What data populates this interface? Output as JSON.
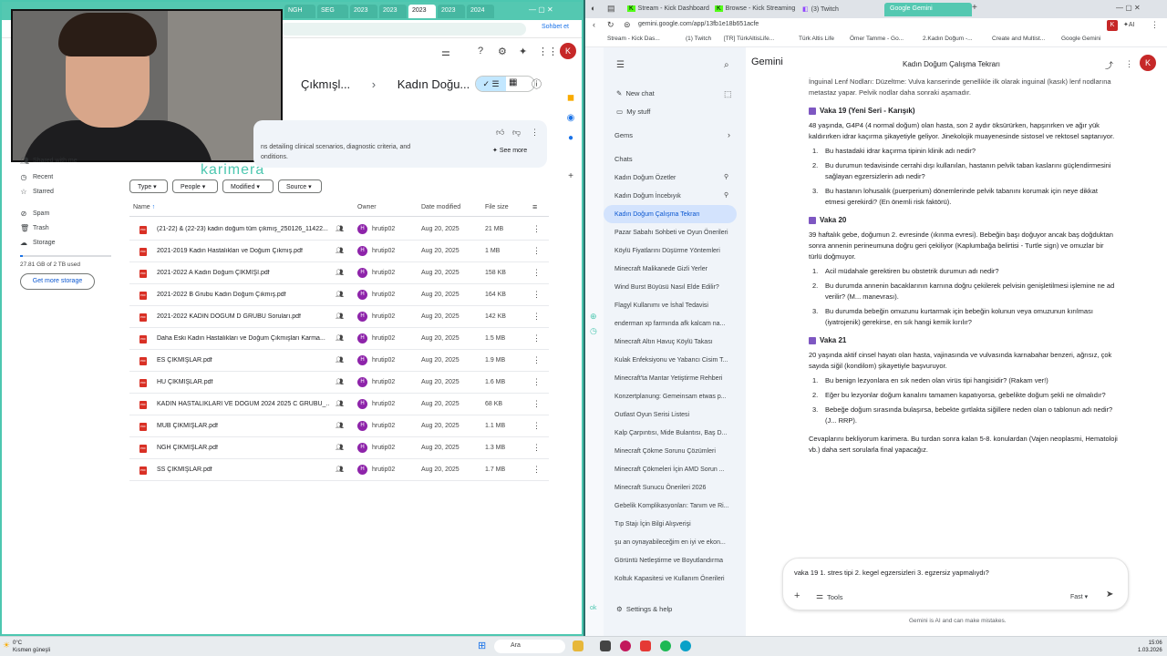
{
  "left_window": {
    "tabs": [
      "NGH",
      "SEG",
      "2023",
      "2023",
      "2023",
      "2023",
      "2024"
    ],
    "schbtn": "Sohbet et",
    "overlay_text": "karimera",
    "breadcrumb": [
      "Çıkmışl...",
      "Kadın Doğu..."
    ],
    "ai_summary": {
      "text_line1": "ns detailing clinical scenarios, diagnostic criteria, and",
      "text_line2": "onditions.",
      "see_more": "See more"
    },
    "nav": [
      {
        "label": "Shared with me",
        "icon": "people-icon"
      },
      {
        "label": "Recent",
        "icon": "clock-icon"
      },
      {
        "label": "Starred",
        "icon": "star-icon"
      },
      {
        "label": "Spam",
        "icon": "spam-icon"
      },
      {
        "label": "Trash",
        "icon": "trash-icon"
      },
      {
        "label": "Storage",
        "icon": "cloud-icon"
      }
    ],
    "storage_text": "27.81 GB of 2 TB used",
    "get_storage": "Get more storage",
    "filters": [
      "Type",
      "People",
      "Modified",
      "Source"
    ],
    "columns": {
      "name": "Name",
      "owner": "Owner",
      "date": "Date modified",
      "size": "File size"
    },
    "files": [
      {
        "name": "(21-22) & (22-23) kadın doğum tüm çıkmış_250126_11422...",
        "owner": "hrutip02",
        "date": "Aug 20, 2025",
        "size": "21 MB"
      },
      {
        "name": "2021-2019 Kadın Hastalıkları ve Doğum Çıkmış.pdf",
        "owner": "hrutip02",
        "date": "Aug 20, 2025",
        "size": "1 MB"
      },
      {
        "name": "2021-2022 A Kadın Doğum ÇIKMIŞI.pdf",
        "owner": "hrutip02",
        "date": "Aug 20, 2025",
        "size": "158 KB"
      },
      {
        "name": "2021-2022 B Grubu Kadın Doğum Çıkmış.pdf",
        "owner": "hrutip02",
        "date": "Aug 20, 2025",
        "size": "164 KB"
      },
      {
        "name": "2021-2022 KADIN DOĞUM D GRUBU Soruları.pdf",
        "owner": "hrutip02",
        "date": "Aug 20, 2025",
        "size": "142 KB"
      },
      {
        "name": "Daha Eski Kadın Hastalıkları ve Doğum Çıkmışları Karma...",
        "owner": "hrutip02",
        "date": "Aug 20, 2025",
        "size": "1.5 MB"
      },
      {
        "name": "ES ÇIKMIŞLAR.pdf",
        "owner": "hrutip02",
        "date": "Aug 20, 2025",
        "size": "1.9 MB"
      },
      {
        "name": "HU ÇIKMIŞLAR.pdf",
        "owner": "hrutip02",
        "date": "Aug 20, 2025",
        "size": "1.6 MB"
      },
      {
        "name": "KADIN HASTALIKLARI VE DOĞUM 2024 2025 C GRUBU_...",
        "owner": "hrutip02",
        "date": "Aug 20, 2025",
        "size": "68 KB"
      },
      {
        "name": "MUB ÇIKMIŞLAR.pdf",
        "owner": "hrutip02",
        "date": "Aug 20, 2025",
        "size": "1.1 MB"
      },
      {
        "name": "NGH ÇIKMIŞLAR.pdf",
        "owner": "hrutip02",
        "date": "Aug 20, 2025",
        "size": "1.3 MB"
      },
      {
        "name": "SS ÇIKMIŞLAR.pdf",
        "owner": "hrutip02",
        "date": "Aug 20, 2025",
        "size": "1.7 MB"
      }
    ]
  },
  "right_window": {
    "tabs": [
      "Stream - Kick Dashboard",
      "Browse - Kick Streaming",
      "(3) Twitch",
      "Google Gemini"
    ],
    "url": "gemini.google.com/app/13fb1e18b651acfe",
    "bookmarks": [
      "Stream - Kick Das...",
      "(1) Twitch",
      "[TR] TürkAltisLife...",
      "Türk Altis Life",
      "Ömer Tamme - Go...",
      "2.Kadın Doğum -...",
      "Create and Multist...",
      "Google Gemini"
    ],
    "gemini_label": "Gemini",
    "chat_title": "Kadın Doğum Çalışma Tekrarı",
    "side": {
      "new_chat": "New chat",
      "my_stuff": "My stuff",
      "gems": "Gems",
      "chats": "Chats",
      "chat_list": [
        "Kadın Doğum Özetler",
        "Kadın Doğum İncebıyık",
        "Kadın Doğum Çalışma Tekrarı",
        "Pazar Sabahı Sohbeti ve Oyun Önerileri",
        "Köylü Fiyatlarını Düşürme Yöntemleri",
        "Minecraft Malikanede Gizli Yerler",
        "Wind Burst Büyüsü Nasıl Elde Edilir?",
        "Flagyl Kullanımı ve İshal Tedavisi",
        "enderman xp farmında afk kalcam na...",
        "Minecraft Altın Havuç Köylü Takası",
        "Kulak Enfeksiyonu ve Yabancı Cisim T...",
        "Minecraft'ta Mantar Yetiştirme Rehberi",
        "Konzertplanung: Gemeinsam etwas p...",
        "Outlast Oyun Serisi Listesi",
        "Kalp Çarpıntısı, Mide Bulantısı, Baş D...",
        "Minecraft Çökme Sorunu Çözümleri",
        "Minecraft Çökmeleri İçin AMD Sorun ...",
        "Minecraft Sunucu Önerileri 2026",
        "Gebelik Komplikasyonları: Tanım ve Ri...",
        "Tıp Stajı İçin Bilgi Alışverişi",
        "şu an oynayabileceğim en iyi ve ekon...",
        "Görüntü Netleştirme ve Boyutlandırma",
        "Koltuk Kapasitesi ve Kullanım Önerileri"
      ],
      "settings": "Settings & help"
    },
    "top_fragment": "İnguinal Lenf Nodları: Düzeltme: Vulva kanserinde genellikle ilk olarak inguinal (kasık) lenf nodlarına metastaz yapar. Pelvik nodlar daha sonraki aşamadır.",
    "cases": [
      {
        "title": "Vaka 19 (Yeni Seri - Karışık)",
        "desc": "48 yaşında, G4P4 (4 normal doğum) olan hasta, son 2 aydır öksürürken, hapşırırken ve ağır yük kaldırırken idrar kaçırma şikayetiyle geliyor. Jinekolojik muayenesinde sistosel ve rektosel saptanıyor.",
        "qs": [
          "Bu hastadaki idrar kaçırma tipinin klinik adı nedir?",
          "Bu durumun tedavisinde cerrahi dışı kullanılan, hastanın pelvik taban kaslarını güçlendirmesini sağlayan egzersizlerin adı nedir?",
          "Bu hastanın lohusalık (puerperium) dönemlerinde pelvik tabanını korumak için neye dikkat etmesi gerekirdi? (En önemli risk faktörü)."
        ]
      },
      {
        "title": "Vaka 20",
        "desc": "39 haftalık gebe, doğumun 2. evresinde (ıkınma evresi). Bebeğin başı doğuyor ancak baş doğduktan sonra annenin perineumuna doğru geri çekiliyor (Kaplumbağa belirtisi - Turtle sign) ve omuzlar bir türlü doğmuyor.",
        "qs": [
          "Acil müdahale gerektiren bu obstetrik durumun adı nedir?",
          "Bu durumda annenin bacaklarının karnına doğru çekilerek pelvisin genişletilmesi işlemine ne ad verilir? (M... manevrası).",
          "Bu durumda bebeğin omuzunu kurtarmak için bebeğin kolunun veya omuzunun kırılması (iyatrojenik) gerekirse, en sık hangi kemik kırılır?"
        ]
      },
      {
        "title": "Vaka 21",
        "desc": "20 yaşında aktif cinsel hayatı olan hasta, vajinasında ve vulvasında karnabahar benzeri, ağrısız, çok sayıda siğil (kondilom) şikayetiyle başvuruyor.",
        "qs": [
          "Bu benign lezyonlara en sık neden olan virüs tipi hangisidir? (Rakam ver!)",
          "Eğer bu lezyonlar doğum kanalını tamamen kapatıyorsa, gebelikte doğum şekli ne olmalıdır?",
          "Bebeğe doğum sırasında bulaşırsa, bebekte gırtlakta siğillere neden olan o tablonun adı nedir? (J... RRP)."
        ]
      }
    ],
    "closing": "Cevaplarını bekliyorum karimera. Bu turdan sonra kalan 5-8. konulardan (Vajen neoplasmi, Hematoloji vb.) daha sert sorularla final yapacağız.",
    "input_text": "vaka 19 1. stres tipi 2. kegel egzersizleri 3. egzersiz yapmalıydı?",
    "tools_label": "Tools",
    "fast_label": "Fast",
    "disclaimer": "Gemini is AI and can make mistakes."
  },
  "taskbar": {
    "weather_temp": "0°C",
    "weather_desc": "Kısmen güneşli",
    "search_placeholder": "Ara",
    "time": "15:06",
    "date": "1.03.2026"
  }
}
